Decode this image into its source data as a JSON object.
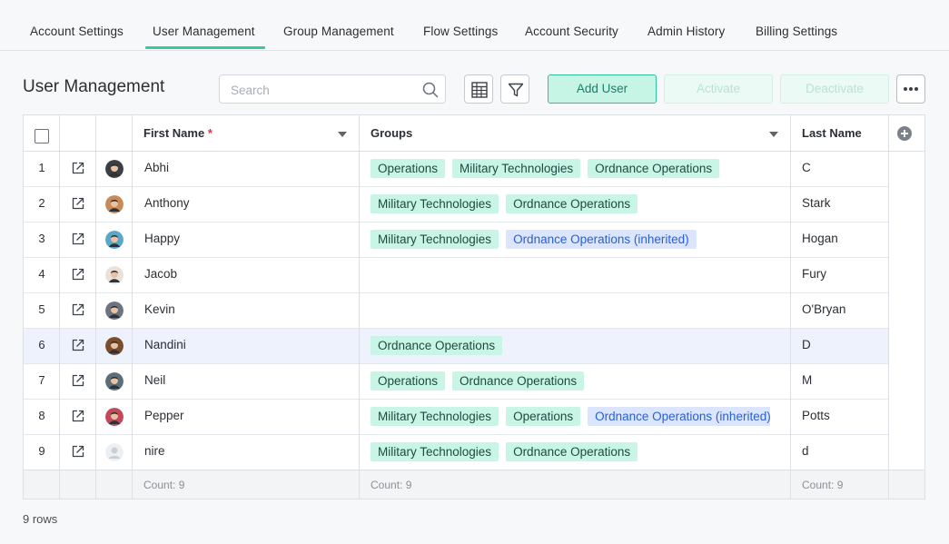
{
  "tabs": [
    {
      "label": "Account Settings"
    },
    {
      "label": "User Management"
    },
    {
      "label": "Group Management"
    },
    {
      "label": "Flow Settings"
    },
    {
      "label": "Account Security"
    },
    {
      "label": "Admin History"
    },
    {
      "label": "Billing Settings"
    }
  ],
  "active_tab": "User Management",
  "page_title": "User Management",
  "search": {
    "placeholder": "Search",
    "value": ""
  },
  "toolbar": {
    "grid_view_icon": "grid-view-icon",
    "filter_icon": "filter-icon",
    "add_user_label": "Add User",
    "activate_label": "Activate",
    "deactivate_label": "Deactivate",
    "more_icon": "more-icon"
  },
  "columns": {
    "first_name": "First Name",
    "required_marker": "*",
    "groups": "Groups",
    "last_name": "Last Name"
  },
  "rows": [
    {
      "num": "1",
      "first": "Abhi",
      "last": "C",
      "groups": [
        {
          "name": "Operations",
          "inherited": false
        },
        {
          "name": "Military Technologies",
          "inherited": false
        },
        {
          "name": "Ordnance Operations",
          "inherited": false
        }
      ]
    },
    {
      "num": "2",
      "first": "Anthony",
      "last": "Stark",
      "groups": [
        {
          "name": "Military Technologies",
          "inherited": false
        },
        {
          "name": "Ordnance Operations",
          "inherited": false
        }
      ]
    },
    {
      "num": "3",
      "first": "Happy",
      "last": "Hogan",
      "groups": [
        {
          "name": "Military Technologies",
          "inherited": false
        },
        {
          "name": "Ordnance Operations (inherited)",
          "inherited": true
        }
      ]
    },
    {
      "num": "4",
      "first": "Jacob",
      "last": "Fury",
      "groups": []
    },
    {
      "num": "5",
      "first": "Kevin",
      "last": "O'Bryan",
      "groups": []
    },
    {
      "num": "6",
      "first": "Nandini",
      "last": "D",
      "groups": [
        {
          "name": "Ordnance Operations",
          "inherited": false
        }
      ],
      "selected": true
    },
    {
      "num": "7",
      "first": "Neil",
      "last": "M",
      "groups": [
        {
          "name": "Operations",
          "inherited": false
        },
        {
          "name": "Ordnance Operations",
          "inherited": false
        }
      ]
    },
    {
      "num": "8",
      "first": "Pepper",
      "last": "Potts",
      "groups": [
        {
          "name": "Military Technologies",
          "inherited": false
        },
        {
          "name": "Operations",
          "inherited": false
        },
        {
          "name": "Ordnance Operations (inherited)",
          "inherited": true
        }
      ]
    },
    {
      "num": "9",
      "first": "nire",
      "last": "d",
      "groups": [
        {
          "name": "Military Technologies",
          "inherited": false
        },
        {
          "name": "Ordnance Operations",
          "inherited": false
        }
      ]
    }
  ],
  "footer": {
    "first_count": "Count: 9",
    "groups_count": "Count: 9",
    "last_count": "Count: 9"
  },
  "rows_count": "9 rows",
  "colors": {
    "accent": "#35c9a6",
    "tag_bg": "#c8f5e6",
    "inherited_tag_bg": "#dbe6fe",
    "inherited_tag_text": "#2a5fd3",
    "selected_row": "#eef2fd"
  }
}
